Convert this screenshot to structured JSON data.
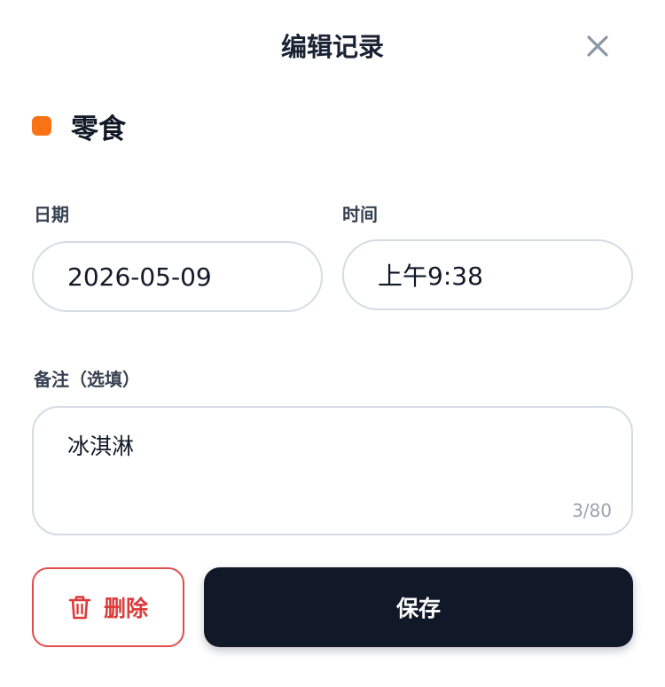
{
  "header": {
    "title": "编辑记录",
    "close_icon": "close-icon"
  },
  "category": {
    "name": "零食",
    "color": "#f97316"
  },
  "date": {
    "label": "日期",
    "value": "2026-05-09"
  },
  "time": {
    "label": "时间",
    "value": "上午9:38"
  },
  "notes": {
    "label": "备注（选填）",
    "value": "冰淇淋",
    "count": "3/80"
  },
  "actions": {
    "delete_label": "删除",
    "delete_icon": "trash-icon",
    "save_label": "保存"
  },
  "colors": {
    "accent": "#111827",
    "danger": "#dc3b3b",
    "border": "#d4dbe3"
  }
}
